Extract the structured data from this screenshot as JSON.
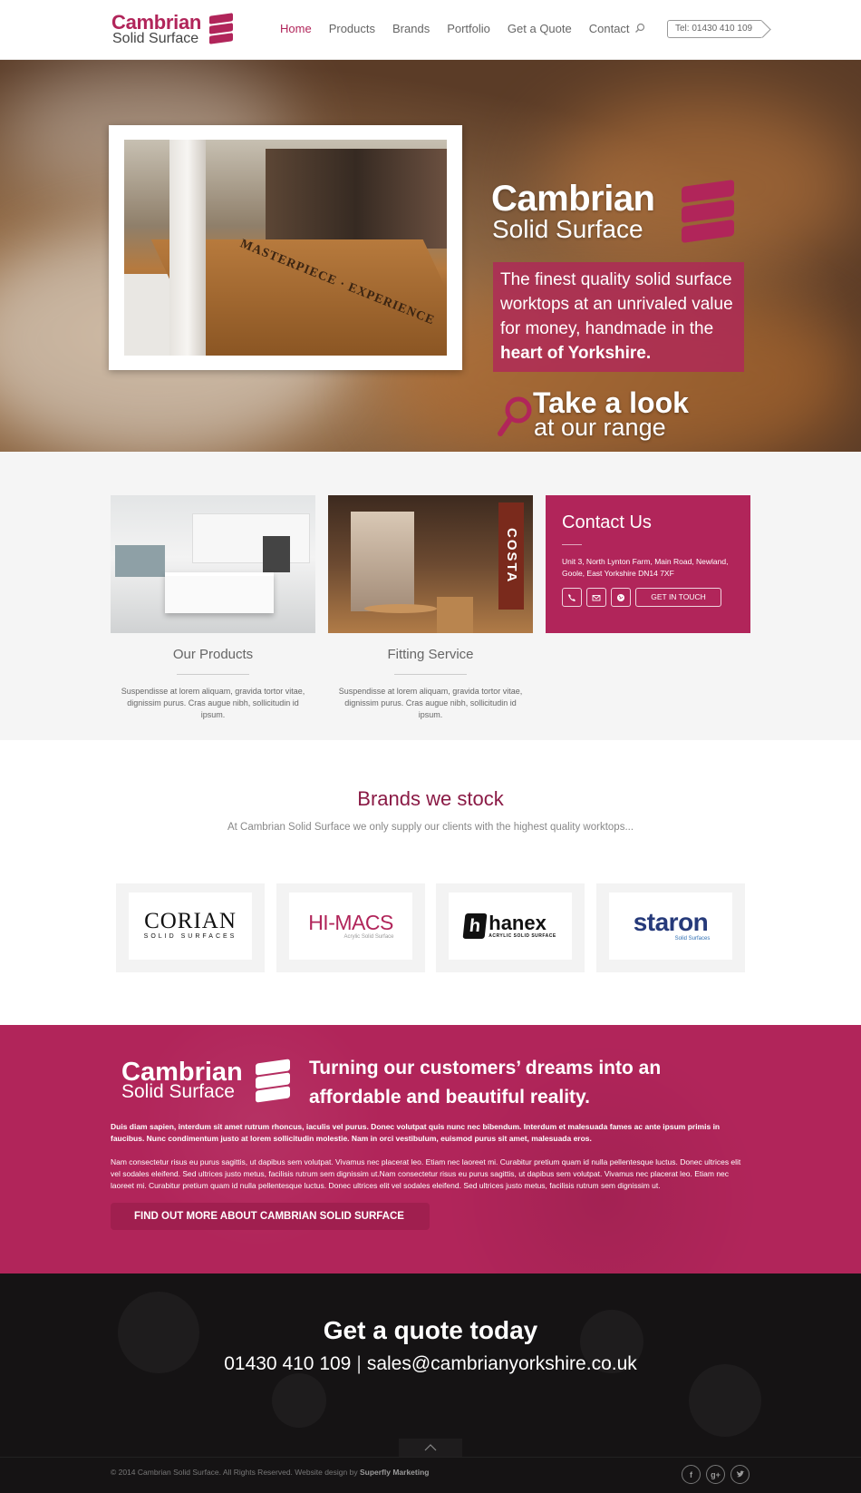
{
  "header": {
    "logo_line1": "Cambrian",
    "logo_line2": "Solid Surface",
    "nav": [
      "Home",
      "Products",
      "Brands",
      "Portfolio",
      "Get a Quote",
      "Contact"
    ],
    "active_nav": "Home",
    "search_icon": "search-icon",
    "tel": "Tel: 01430 410 109"
  },
  "hero": {
    "brand_line1": "Cambrian",
    "brand_line2": "Solid Surface",
    "tagline_plain": "The finest quality solid surface worktops at an unrivaled value for money, handmade in the",
    "tagline_bold": "heart of Yorkshire.",
    "look_line1": "Take a look",
    "look_line2": "at our range",
    "photo_counter_text": "MASTERPIECE · EXPERIENCE"
  },
  "features": {
    "items": [
      {
        "title": "Our Products",
        "desc": "Suspendisse at lorem aliquam, gravida tortor vitae, dignissim purus. Cras augue nibh, sollicitudin id ipsum."
      },
      {
        "title": "Fitting Service",
        "desc": "Suspendisse at lorem aliquam, gravida tortor vitae, dignissim purus. Cras augue nibh, sollicitudin id ipsum."
      }
    ],
    "photo_shop_sign": "COSTA",
    "contact": {
      "title": "Contact Us",
      "address": "Unit 3, North Lynton Farm, Main Road, Newland, Goole, East Yorkshire DN14 7XF",
      "button": "GET IN TOUCH",
      "icons": [
        "phone-icon",
        "mail-icon",
        "globe-icon"
      ]
    }
  },
  "brands": {
    "title": "Brands we stock",
    "subtitle": "At Cambrian Solid Surface we only supply our clients with the highest quality worktops...",
    "logos": {
      "corian_main": "CORIAN",
      "corian_sub": "SOLID SURFACES",
      "himacs_main": "HI-MACS",
      "himacs_sub": "Acrylic Solid Surface",
      "hanex_badge": "h",
      "hanex_main": "hanex",
      "hanex_sub": "ACRYLIC SOLID SURFACE",
      "staron_main": "staron",
      "staron_sub": "Solid Surfaces"
    }
  },
  "about": {
    "logo_line1": "Cambrian",
    "logo_line2": "Solid Surface",
    "heading": "Turning our customers’ dreams into an affordable and beautiful reality.",
    "para1": "Duis diam sapien, interdum sit amet rutrum rhoncus, iaculis vel purus. Donec volutpat quis nunc nec bibendum. Interdum et malesuada fames ac ante ipsum primis in faucibus. Nunc condimentum justo at lorem sollicitudin molestie. Nam in orci vestibulum, euismod purus sit amet, malesuada eros.",
    "para2": "Nam consectetur risus eu purus sagittis, ut dapibus sem volutpat. Vivamus nec placerat leo. Etiam nec laoreet mi. Curabitur pretium quam id nulla pellentesque luctus. Donec ultrices elit vel sodales eleifend. Sed ultrices justo metus, facilisis rutrum sem dignissim ut.Nam consectetur risus eu purus sagittis, ut dapibus sem volutpat. Vivamus nec placerat leo. Etiam nec laoreet mi. Curabitur pretium quam id nulla pellentesque luctus. Donec ultrices elit vel sodales eleifend. Sed ultrices justo metus, facilisis rutrum sem dignissim ut.",
    "button": "FIND OUT MORE ABOUT CAMBRIAN SOLID SURFACE"
  },
  "quote": {
    "title": "Get a quote today",
    "phone": "01430 410 109",
    "separator": "|",
    "email": "sales@cambrianyorkshire.co.uk"
  },
  "footer": {
    "copyright": "© 2014 Cambrian Solid Surface. All Rights Reserved. Website design by",
    "designer": "Superfly Marketing",
    "socials": [
      "facebook-icon",
      "google-plus-icon",
      "twitter-icon"
    ],
    "social_labels": [
      "f",
      "g+",
      ""
    ]
  },
  "colors": {
    "brand": "#b1255a",
    "dark": "#151314"
  }
}
